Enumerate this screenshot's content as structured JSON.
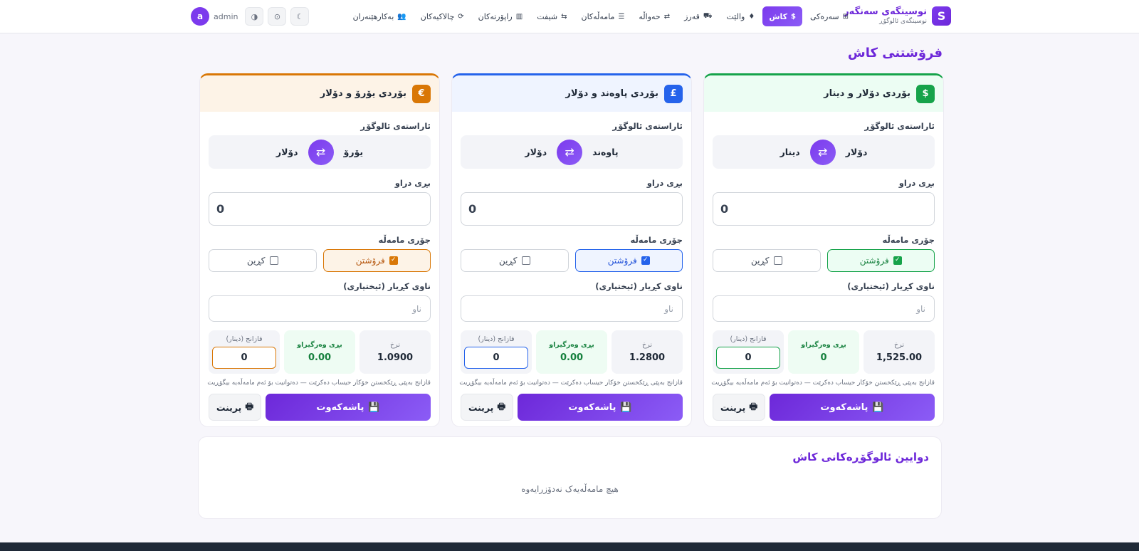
{
  "brand": {
    "logo": "S",
    "title": "نوسینگەی سەنگەر",
    "subtitle": "نوسینگەی ئالوگۆڕ"
  },
  "nav": {
    "items": [
      {
        "label": "سەرەکی",
        "icon": "⊞",
        "active": false
      },
      {
        "label": "کاش",
        "icon": "$",
        "active": true
      },
      {
        "label": "والێت",
        "icon": "♦",
        "active": false
      },
      {
        "label": "قەرز",
        "icon": "⛟",
        "active": false
      },
      {
        "label": "حەواڵە",
        "icon": "⇄",
        "active": false
      },
      {
        "label": "مامەڵەکان",
        "icon": "☰",
        "active": false
      },
      {
        "label": "شیفت",
        "icon": "⇆",
        "active": false
      },
      {
        "label": "راپۆرتەکان",
        "icon": "▥",
        "active": false
      },
      {
        "label": "چالاکیەکان",
        "icon": "⟳",
        "active": false
      },
      {
        "label": "بەکارهێنەران",
        "icon": "👥",
        "active": false
      }
    ],
    "user": {
      "initial": "a",
      "name": "admin"
    },
    "tools": [
      "◑",
      "⊙",
      "☾"
    ]
  },
  "page_title": "فرۆشتنی کاش",
  "cards": [
    {
      "accent": "#16a34a",
      "head_bg": "#ecfdf3",
      "icon": "$",
      "title": "بۆردی دۆلار و دینار",
      "direction_label": "ئاراستەی ئالوگۆڕ",
      "from": "دۆلار",
      "to": "دینار",
      "amount_label": "بڕی دراو",
      "amount": "0",
      "type_label": "جۆری مامەڵە",
      "sell": "فرۆشتن",
      "buy": "کڕین",
      "sell_bg": "#ecfdf3",
      "sell_color": "#15803d",
      "name_label": "ناوی کڕیار (ئیختیاری)",
      "name_placeholder": "ناو",
      "rate_label": "نرخ",
      "rate": "1,525.00",
      "received_label": "بڕی وەرگیراو",
      "received": "0",
      "profit_label": "قازانج (دینار)",
      "profit": "0",
      "note": "قازانج بەپێی ڕێکخستن خۆکار حیساب دەکرێت — دەتوانیت بۆ ئەم مامەڵەیە بیگۆڕیت",
      "save": "پاشەکەوت",
      "print": "پرینت"
    },
    {
      "accent": "#2563eb",
      "head_bg": "#eff4ff",
      "icon": "£",
      "title": "بۆردی پاوەند و دۆلار",
      "direction_label": "ئاراستەی ئالوگۆڕ",
      "from": "پاوەند",
      "to": "دۆلار",
      "amount_label": "بڕی دراو",
      "amount": "0",
      "type_label": "جۆری مامەڵە",
      "sell": "فرۆشتن",
      "buy": "کڕین",
      "sell_bg": "#eff4ff",
      "sell_color": "#1d4ed8",
      "name_label": "ناوی کڕیار (ئیختیاری)",
      "name_placeholder": "ناو",
      "rate_label": "نرخ",
      "rate": "1.2800",
      "received_label": "بڕی وەرگیراو",
      "received": "0.00",
      "profit_label": "قازانج (دینار)",
      "profit": "0",
      "note": "قازانج بەپێی ڕێکخستن خۆکار حیساب دەکرێت — دەتوانیت بۆ ئەم مامەڵەیە بیگۆڕیت",
      "save": "پاشەکەوت",
      "print": "پرینت"
    },
    {
      "accent": "#d97706",
      "head_bg": "#fdf3e7",
      "icon": "€",
      "title": "بۆردی یۆرۆ و دۆلار",
      "direction_label": "ئاراستەی ئالوگۆڕ",
      "from": "یۆرۆ",
      "to": "دۆلار",
      "amount_label": "بڕی دراو",
      "amount": "0",
      "type_label": "جۆری مامەڵە",
      "sell": "فرۆشتن",
      "buy": "کڕین",
      "sell_bg": "#fdf3e7",
      "sell_color": "#b45309",
      "name_label": "ناوی کڕیار (ئیختیاری)",
      "name_placeholder": "ناو",
      "rate_label": "نرخ",
      "rate": "1.0900",
      "received_label": "بڕی وەرگیراو",
      "received": "0.00",
      "profit_label": "قازانج (دینار)",
      "profit": "0",
      "note": "قازانج بەپێی ڕێکخستن خۆکار حیساب دەکرێت — دەتوانیت بۆ ئەم مامەڵەیە بیگۆڕیت",
      "save": "پاشەکەوت",
      "print": "پرینت"
    }
  ],
  "recent": {
    "title": "دوایین ئالوگۆڕەکانی کاش",
    "empty": "هیچ مامەڵەیەک نەدۆزرایەوە"
  }
}
